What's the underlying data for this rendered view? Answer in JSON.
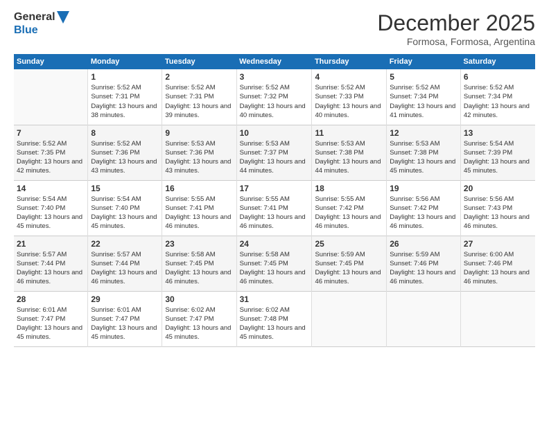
{
  "header": {
    "logo_line1": "General",
    "logo_line2": "Blue",
    "month": "December 2025",
    "location": "Formosa, Formosa, Argentina"
  },
  "days_of_week": [
    "Sunday",
    "Monday",
    "Tuesday",
    "Wednesday",
    "Thursday",
    "Friday",
    "Saturday"
  ],
  "weeks": [
    [
      {
        "day": "",
        "empty": true
      },
      {
        "day": "1",
        "sunrise": "Sunrise: 5:52 AM",
        "sunset": "Sunset: 7:31 PM",
        "daylight": "Daylight: 13 hours and 38 minutes."
      },
      {
        "day": "2",
        "sunrise": "Sunrise: 5:52 AM",
        "sunset": "Sunset: 7:31 PM",
        "daylight": "Daylight: 13 hours and 39 minutes."
      },
      {
        "day": "3",
        "sunrise": "Sunrise: 5:52 AM",
        "sunset": "Sunset: 7:32 PM",
        "daylight": "Daylight: 13 hours and 40 minutes."
      },
      {
        "day": "4",
        "sunrise": "Sunrise: 5:52 AM",
        "sunset": "Sunset: 7:33 PM",
        "daylight": "Daylight: 13 hours and 40 minutes."
      },
      {
        "day": "5",
        "sunrise": "Sunrise: 5:52 AM",
        "sunset": "Sunset: 7:34 PM",
        "daylight": "Daylight: 13 hours and 41 minutes."
      },
      {
        "day": "6",
        "sunrise": "Sunrise: 5:52 AM",
        "sunset": "Sunset: 7:34 PM",
        "daylight": "Daylight: 13 hours and 42 minutes."
      }
    ],
    [
      {
        "day": "7",
        "sunrise": "Sunrise: 5:52 AM",
        "sunset": "Sunset: 7:35 PM",
        "daylight": "Daylight: 13 hours and 42 minutes."
      },
      {
        "day": "8",
        "sunrise": "Sunrise: 5:52 AM",
        "sunset": "Sunset: 7:36 PM",
        "daylight": "Daylight: 13 hours and 43 minutes."
      },
      {
        "day": "9",
        "sunrise": "Sunrise: 5:53 AM",
        "sunset": "Sunset: 7:36 PM",
        "daylight": "Daylight: 13 hours and 43 minutes."
      },
      {
        "day": "10",
        "sunrise": "Sunrise: 5:53 AM",
        "sunset": "Sunset: 7:37 PM",
        "daylight": "Daylight: 13 hours and 44 minutes."
      },
      {
        "day": "11",
        "sunrise": "Sunrise: 5:53 AM",
        "sunset": "Sunset: 7:38 PM",
        "daylight": "Daylight: 13 hours and 44 minutes."
      },
      {
        "day": "12",
        "sunrise": "Sunrise: 5:53 AM",
        "sunset": "Sunset: 7:38 PM",
        "daylight": "Daylight: 13 hours and 45 minutes."
      },
      {
        "day": "13",
        "sunrise": "Sunrise: 5:54 AM",
        "sunset": "Sunset: 7:39 PM",
        "daylight": "Daylight: 13 hours and 45 minutes."
      }
    ],
    [
      {
        "day": "14",
        "sunrise": "Sunrise: 5:54 AM",
        "sunset": "Sunset: 7:40 PM",
        "daylight": "Daylight: 13 hours and 45 minutes."
      },
      {
        "day": "15",
        "sunrise": "Sunrise: 5:54 AM",
        "sunset": "Sunset: 7:40 PM",
        "daylight": "Daylight: 13 hours and 45 minutes."
      },
      {
        "day": "16",
        "sunrise": "Sunrise: 5:55 AM",
        "sunset": "Sunset: 7:41 PM",
        "daylight": "Daylight: 13 hours and 46 minutes."
      },
      {
        "day": "17",
        "sunrise": "Sunrise: 5:55 AM",
        "sunset": "Sunset: 7:41 PM",
        "daylight": "Daylight: 13 hours and 46 minutes."
      },
      {
        "day": "18",
        "sunrise": "Sunrise: 5:55 AM",
        "sunset": "Sunset: 7:42 PM",
        "daylight": "Daylight: 13 hours and 46 minutes."
      },
      {
        "day": "19",
        "sunrise": "Sunrise: 5:56 AM",
        "sunset": "Sunset: 7:42 PM",
        "daylight": "Daylight: 13 hours and 46 minutes."
      },
      {
        "day": "20",
        "sunrise": "Sunrise: 5:56 AM",
        "sunset": "Sunset: 7:43 PM",
        "daylight": "Daylight: 13 hours and 46 minutes."
      }
    ],
    [
      {
        "day": "21",
        "sunrise": "Sunrise: 5:57 AM",
        "sunset": "Sunset: 7:44 PM",
        "daylight": "Daylight: 13 hours and 46 minutes."
      },
      {
        "day": "22",
        "sunrise": "Sunrise: 5:57 AM",
        "sunset": "Sunset: 7:44 PM",
        "daylight": "Daylight: 13 hours and 46 minutes."
      },
      {
        "day": "23",
        "sunrise": "Sunrise: 5:58 AM",
        "sunset": "Sunset: 7:45 PM",
        "daylight": "Daylight: 13 hours and 46 minutes."
      },
      {
        "day": "24",
        "sunrise": "Sunrise: 5:58 AM",
        "sunset": "Sunset: 7:45 PM",
        "daylight": "Daylight: 13 hours and 46 minutes."
      },
      {
        "day": "25",
        "sunrise": "Sunrise: 5:59 AM",
        "sunset": "Sunset: 7:45 PM",
        "daylight": "Daylight: 13 hours and 46 minutes."
      },
      {
        "day": "26",
        "sunrise": "Sunrise: 5:59 AM",
        "sunset": "Sunset: 7:46 PM",
        "daylight": "Daylight: 13 hours and 46 minutes."
      },
      {
        "day": "27",
        "sunrise": "Sunrise: 6:00 AM",
        "sunset": "Sunset: 7:46 PM",
        "daylight": "Daylight: 13 hours and 46 minutes."
      }
    ],
    [
      {
        "day": "28",
        "sunrise": "Sunrise: 6:01 AM",
        "sunset": "Sunset: 7:47 PM",
        "daylight": "Daylight: 13 hours and 45 minutes."
      },
      {
        "day": "29",
        "sunrise": "Sunrise: 6:01 AM",
        "sunset": "Sunset: 7:47 PM",
        "daylight": "Daylight: 13 hours and 45 minutes."
      },
      {
        "day": "30",
        "sunrise": "Sunrise: 6:02 AM",
        "sunset": "Sunset: 7:47 PM",
        "daylight": "Daylight: 13 hours and 45 minutes."
      },
      {
        "day": "31",
        "sunrise": "Sunrise: 6:02 AM",
        "sunset": "Sunset: 7:48 PM",
        "daylight": "Daylight: 13 hours and 45 minutes."
      },
      {
        "day": "",
        "empty": true
      },
      {
        "day": "",
        "empty": true
      },
      {
        "day": "",
        "empty": true
      }
    ]
  ]
}
